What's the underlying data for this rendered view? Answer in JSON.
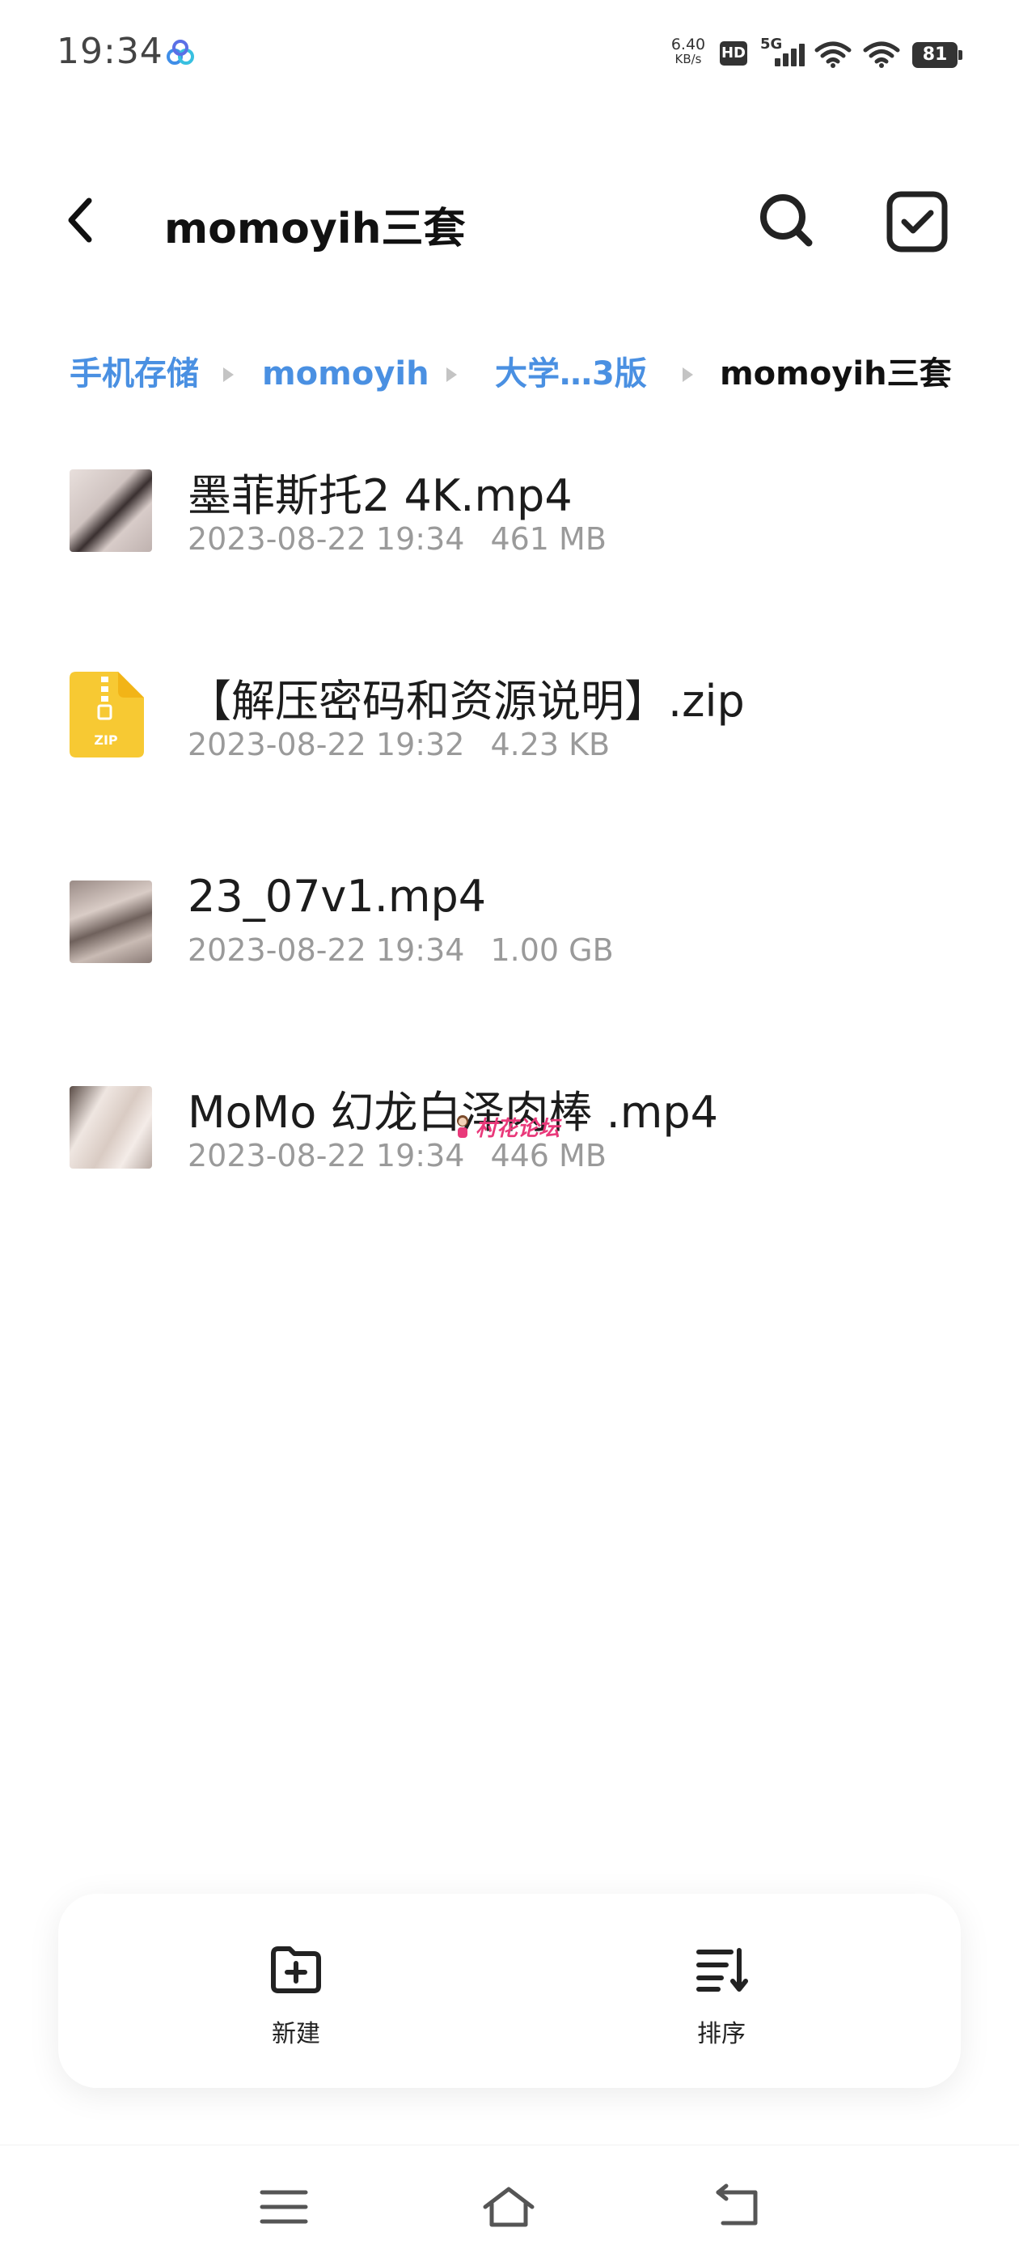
{
  "status_bar": {
    "time": "19:34",
    "net_speed_value": "6.40",
    "net_speed_unit": "KB/s",
    "hd_label": "HD",
    "network_label": "5G",
    "battery": "81"
  },
  "header": {
    "title": "momoyih三套"
  },
  "breadcrumb": [
    {
      "label": "手机存储"
    },
    {
      "label": "momoyih"
    },
    {
      "label": "大学…3版"
    },
    {
      "label": "momoyih三套"
    }
  ],
  "files": [
    {
      "name": "墨菲斯托2 4K.mp4",
      "date": "2023-08-22 19:34",
      "size": "461 MB",
      "type": "video"
    },
    {
      "name": "【解压密码和资源说明】.zip",
      "date": "2023-08-22 19:32",
      "size": "4.23 KB",
      "type": "zip"
    },
    {
      "name": "23_07v1.mp4",
      "date": "2023-08-22 19:34",
      "size": "1.00 GB",
      "type": "video"
    },
    {
      "name": "MoMo 幻龙白泽肉棒 .mp4",
      "date": "2023-08-22 19:34",
      "size": "446 MB",
      "type": "video"
    }
  ],
  "zip_icon_label": "ZIP",
  "watermark_text": "村花论坛",
  "actions": {
    "new_label": "新建",
    "sort_label": "排序"
  },
  "colors": {
    "breadcrumb_link": "#4a90e2",
    "zip_yellow": "#f7c933",
    "meta_gray": "#9a9a9a"
  },
  "icons": [
    "back-icon",
    "search-icon",
    "select-icon",
    "zip-icon",
    "new-folder-icon",
    "sort-icon",
    "menu-icon",
    "home-icon",
    "back-nav-icon"
  ]
}
